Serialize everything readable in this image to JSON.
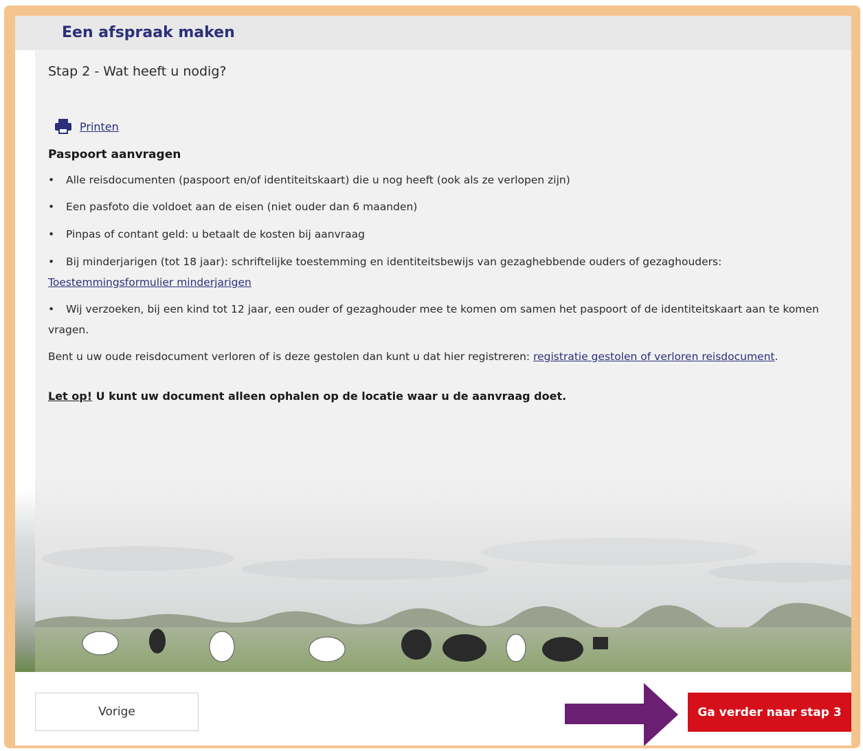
{
  "header": {
    "title": "Een afspraak maken"
  },
  "step": {
    "title": "Stap 2 - Wat heeft u nodig?"
  },
  "print": {
    "label": "Printen",
    "icon": "printer-icon"
  },
  "section": {
    "title": "Paspoort aanvragen",
    "items": [
      {
        "text": "Alle reisdocumenten (paspoort en/of identiteitskaart) die u nog heeft (ook als ze verlopen zijn)"
      },
      {
        "text": "Een pasfoto die voldoet aan de eisen (niet ouder dan 6 maanden)"
      },
      {
        "text": "Pinpas of contant geld: u betaalt de kosten bij aanvraag"
      },
      {
        "text": "Bij minderjarigen (tot 18 jaar): schriftelijke toestemming en identiteitsbewijs van gezaghebbende ouders of gezaghouders:",
        "link": "Toestemmingsformulier minderjarigen"
      },
      {
        "text": "Wij verzoeken, bij een kind tot 12 jaar, een ouder of gezaghouder mee te komen om samen het paspoort of de identiteitskaart aan te komen",
        "continuation": "vragen."
      }
    ],
    "lost_text": "Bent u uw oude reisdocument verloren of is deze gestolen dan kunt u dat hier registreren:",
    "lost_link": "registratie gestolen of verloren reisdocument",
    "lost_suffix": "."
  },
  "notice": {
    "prefix": "Let op!",
    "text": " U kunt uw document alleen ophalen op de locatie waar u de aanvraag doet."
  },
  "footer": {
    "prev_label": "Vorige",
    "next_label": "Ga verder naar stap 3"
  },
  "colors": {
    "frame": "#f4c48e",
    "header_text": "#2b2f7a",
    "link": "#2b2f7a",
    "next_button": "#d5101a",
    "arrow": "#6b1f73"
  }
}
